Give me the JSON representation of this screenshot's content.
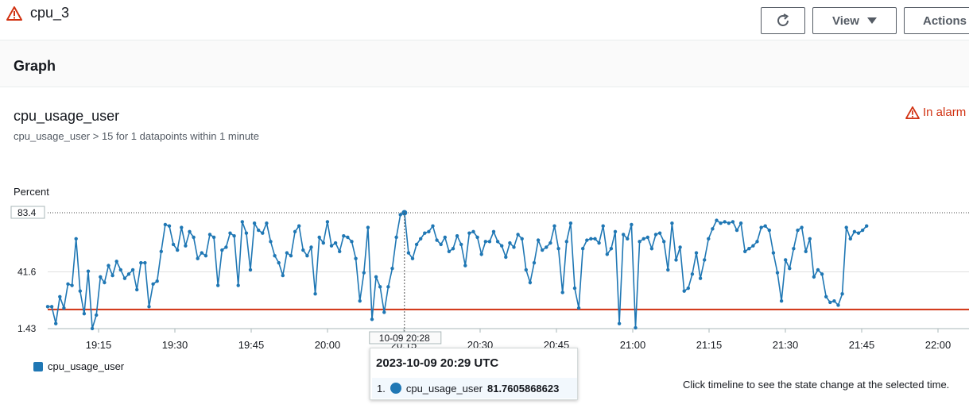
{
  "header": {
    "alarm_name": "cpu_3",
    "view_label": "View",
    "actions_label": "Actions"
  },
  "section": {
    "title": "Graph"
  },
  "metric": {
    "title": "cpu_usage_user",
    "description": "cpu_usage_user > 15 for 1 datapoints within 1 minute",
    "status": "In alarm",
    "unit": "Percent"
  },
  "legend": {
    "label": "cpu_usage_user"
  },
  "hint": "Click timeline to see the state change at the selected time.",
  "tooltip": {
    "time": "2023-10-09 20:29 UTC",
    "index": "1.",
    "series": "cpu_usage_user",
    "value": "81.7605868623"
  },
  "colors": {
    "series": "#1f77b4",
    "threshold": "#d13212",
    "alarm": "#d13212"
  },
  "chart_data": {
    "type": "line",
    "x_tick_labels": [
      "19:15",
      "19:30",
      "19:45",
      "20:00",
      "20:15",
      "20:30",
      "20:45",
      "21:00",
      "21:15",
      "21:30",
      "21:45",
      "22:00"
    ],
    "y_tick_labels": [
      "1.43",
      "41.6",
      "83.4"
    ],
    "ylim": [
      1.43,
      83.4
    ],
    "threshold": 15,
    "crosshair_label": "10-09 20:28",
    "x_start": "19:04",
    "x_interval_minutes": 1,
    "series": [
      {
        "name": "cpu_usage_user",
        "values": [
          17,
          17,
          5,
          24,
          16,
          33,
          32,
          65,
          28,
          12,
          42,
          1.5,
          11,
          38,
          34,
          46,
          39,
          49,
          43,
          37,
          40,
          43,
          29,
          48,
          48,
          17,
          33,
          35,
          56,
          75,
          74,
          61,
          57,
          73,
          60,
          70,
          66,
          51,
          55,
          53,
          68,
          66,
          32,
          57,
          59,
          69,
          67,
          32,
          77,
          69,
          43,
          76,
          71,
          69,
          76,
          63,
          53,
          48,
          39,
          55,
          53,
          70,
          74,
          57,
          53,
          59,
          26,
          66,
          62,
          77,
          60,
          62,
          56,
          67,
          66,
          63,
          51,
          21,
          41,
          73,
          8,
          38,
          31,
          13,
          31,
          44,
          66,
          82,
          83.4,
          55,
          51,
          61,
          65,
          69,
          70,
          74,
          64,
          61,
          66,
          56,
          58,
          67,
          61,
          46,
          69,
          70,
          66,
          54,
          63,
          63,
          70,
          63,
          60,
          52,
          62,
          59,
          68,
          65,
          43,
          34,
          48,
          64,
          57,
          59,
          62,
          74,
          58,
          27,
          63,
          76,
          30,
          16,
          58,
          64,
          65,
          65,
          62,
          74,
          54,
          58,
          70,
          5,
          68,
          65,
          75,
          2,
          63,
          65,
          66,
          58,
          68,
          69,
          63,
          43,
          76,
          50,
          59,
          28,
          30,
          40,
          55,
          37,
          50,
          65,
          72,
          78,
          76,
          77,
          76,
          77,
          71,
          76,
          56,
          58,
          60,
          63,
          73,
          74,
          71,
          55,
          41,
          21,
          50,
          44,
          58,
          71,
          73,
          56,
          65,
          38,
          43,
          40,
          24,
          20,
          21,
          18,
          26,
          73,
          65,
          70,
          69,
          71,
          74
        ]
      }
    ]
  }
}
